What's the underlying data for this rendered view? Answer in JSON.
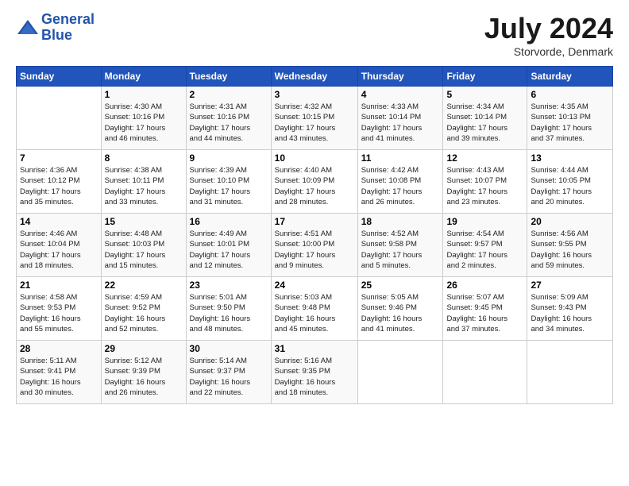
{
  "header": {
    "logo_line1": "General",
    "logo_line2": "Blue",
    "month_title": "July 2024",
    "location": "Storvorde, Denmark"
  },
  "weekdays": [
    "Sunday",
    "Monday",
    "Tuesday",
    "Wednesday",
    "Thursday",
    "Friday",
    "Saturday"
  ],
  "weeks": [
    [
      {
        "day": "",
        "info": ""
      },
      {
        "day": "1",
        "info": "Sunrise: 4:30 AM\nSunset: 10:16 PM\nDaylight: 17 hours\nand 46 minutes."
      },
      {
        "day": "2",
        "info": "Sunrise: 4:31 AM\nSunset: 10:16 PM\nDaylight: 17 hours\nand 44 minutes."
      },
      {
        "day": "3",
        "info": "Sunrise: 4:32 AM\nSunset: 10:15 PM\nDaylight: 17 hours\nand 43 minutes."
      },
      {
        "day": "4",
        "info": "Sunrise: 4:33 AM\nSunset: 10:14 PM\nDaylight: 17 hours\nand 41 minutes."
      },
      {
        "day": "5",
        "info": "Sunrise: 4:34 AM\nSunset: 10:14 PM\nDaylight: 17 hours\nand 39 minutes."
      },
      {
        "day": "6",
        "info": "Sunrise: 4:35 AM\nSunset: 10:13 PM\nDaylight: 17 hours\nand 37 minutes."
      }
    ],
    [
      {
        "day": "7",
        "info": "Sunrise: 4:36 AM\nSunset: 10:12 PM\nDaylight: 17 hours\nand 35 minutes."
      },
      {
        "day": "8",
        "info": "Sunrise: 4:38 AM\nSunset: 10:11 PM\nDaylight: 17 hours\nand 33 minutes."
      },
      {
        "day": "9",
        "info": "Sunrise: 4:39 AM\nSunset: 10:10 PM\nDaylight: 17 hours\nand 31 minutes."
      },
      {
        "day": "10",
        "info": "Sunrise: 4:40 AM\nSunset: 10:09 PM\nDaylight: 17 hours\nand 28 minutes."
      },
      {
        "day": "11",
        "info": "Sunrise: 4:42 AM\nSunset: 10:08 PM\nDaylight: 17 hours\nand 26 minutes."
      },
      {
        "day": "12",
        "info": "Sunrise: 4:43 AM\nSunset: 10:07 PM\nDaylight: 17 hours\nand 23 minutes."
      },
      {
        "day": "13",
        "info": "Sunrise: 4:44 AM\nSunset: 10:05 PM\nDaylight: 17 hours\nand 20 minutes."
      }
    ],
    [
      {
        "day": "14",
        "info": "Sunrise: 4:46 AM\nSunset: 10:04 PM\nDaylight: 17 hours\nand 18 minutes."
      },
      {
        "day": "15",
        "info": "Sunrise: 4:48 AM\nSunset: 10:03 PM\nDaylight: 17 hours\nand 15 minutes."
      },
      {
        "day": "16",
        "info": "Sunrise: 4:49 AM\nSunset: 10:01 PM\nDaylight: 17 hours\nand 12 minutes."
      },
      {
        "day": "17",
        "info": "Sunrise: 4:51 AM\nSunset: 10:00 PM\nDaylight: 17 hours\nand 9 minutes."
      },
      {
        "day": "18",
        "info": "Sunrise: 4:52 AM\nSunset: 9:58 PM\nDaylight: 17 hours\nand 5 minutes."
      },
      {
        "day": "19",
        "info": "Sunrise: 4:54 AM\nSunset: 9:57 PM\nDaylight: 17 hours\nand 2 minutes."
      },
      {
        "day": "20",
        "info": "Sunrise: 4:56 AM\nSunset: 9:55 PM\nDaylight: 16 hours\nand 59 minutes."
      }
    ],
    [
      {
        "day": "21",
        "info": "Sunrise: 4:58 AM\nSunset: 9:53 PM\nDaylight: 16 hours\nand 55 minutes."
      },
      {
        "day": "22",
        "info": "Sunrise: 4:59 AM\nSunset: 9:52 PM\nDaylight: 16 hours\nand 52 minutes."
      },
      {
        "day": "23",
        "info": "Sunrise: 5:01 AM\nSunset: 9:50 PM\nDaylight: 16 hours\nand 48 minutes."
      },
      {
        "day": "24",
        "info": "Sunrise: 5:03 AM\nSunset: 9:48 PM\nDaylight: 16 hours\nand 45 minutes."
      },
      {
        "day": "25",
        "info": "Sunrise: 5:05 AM\nSunset: 9:46 PM\nDaylight: 16 hours\nand 41 minutes."
      },
      {
        "day": "26",
        "info": "Sunrise: 5:07 AM\nSunset: 9:45 PM\nDaylight: 16 hours\nand 37 minutes."
      },
      {
        "day": "27",
        "info": "Sunrise: 5:09 AM\nSunset: 9:43 PM\nDaylight: 16 hours\nand 34 minutes."
      }
    ],
    [
      {
        "day": "28",
        "info": "Sunrise: 5:11 AM\nSunset: 9:41 PM\nDaylight: 16 hours\nand 30 minutes."
      },
      {
        "day": "29",
        "info": "Sunrise: 5:12 AM\nSunset: 9:39 PM\nDaylight: 16 hours\nand 26 minutes."
      },
      {
        "day": "30",
        "info": "Sunrise: 5:14 AM\nSunset: 9:37 PM\nDaylight: 16 hours\nand 22 minutes."
      },
      {
        "day": "31",
        "info": "Sunrise: 5:16 AM\nSunset: 9:35 PM\nDaylight: 16 hours\nand 18 minutes."
      },
      {
        "day": "",
        "info": ""
      },
      {
        "day": "",
        "info": ""
      },
      {
        "day": "",
        "info": ""
      }
    ]
  ]
}
